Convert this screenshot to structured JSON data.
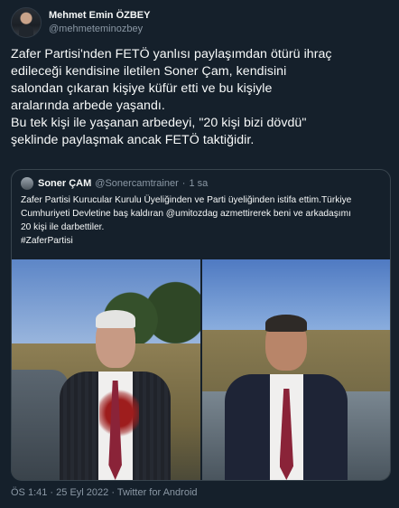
{
  "author": {
    "name": "Mehmet Emin ÖZBEY",
    "handle": "@mehmeteminozbey"
  },
  "tweet": {
    "text": "Zafer Partisi'nden FETÖ yanlısı paylaşımdan ötürü ihraç\nedileceği kendisine iletilen Soner Çam, kendisini\nsalondan çıkaran kişiye küfür etti ve bu kişiyle\naralarında arbede yaşandı.\nBu tek kişi ile yaşanan arbedeyi, \"20 kişi bizi dövdü\"\nşeklinde paylaşmak ancak FETÖ taktiğidir."
  },
  "quoted": {
    "name": "Soner ÇAM",
    "handle": "@Sonercamtrainer",
    "separator": "·",
    "time": "1 sa",
    "text": "Zafer Partisi Kurucular Kurulu Üyeliğinden ve Parti üyeliğinden istifa ettim.Türkiye\nCumhuriyeti Devletine baş kaldıran  @umitozdag azmettirerek beni ve arkadaşımı\n20 kişi ile darbettiler.\n#ZaferPartisi"
  },
  "footer": {
    "time": "ÖS 1:41",
    "date": "25 Eyl 2022",
    "client": "Twitter for Android",
    "separator": "·"
  },
  "colors": {
    "background": "#15202b",
    "text": "#f7f9f9",
    "muted": "#8b98a5",
    "border": "#38444d"
  }
}
